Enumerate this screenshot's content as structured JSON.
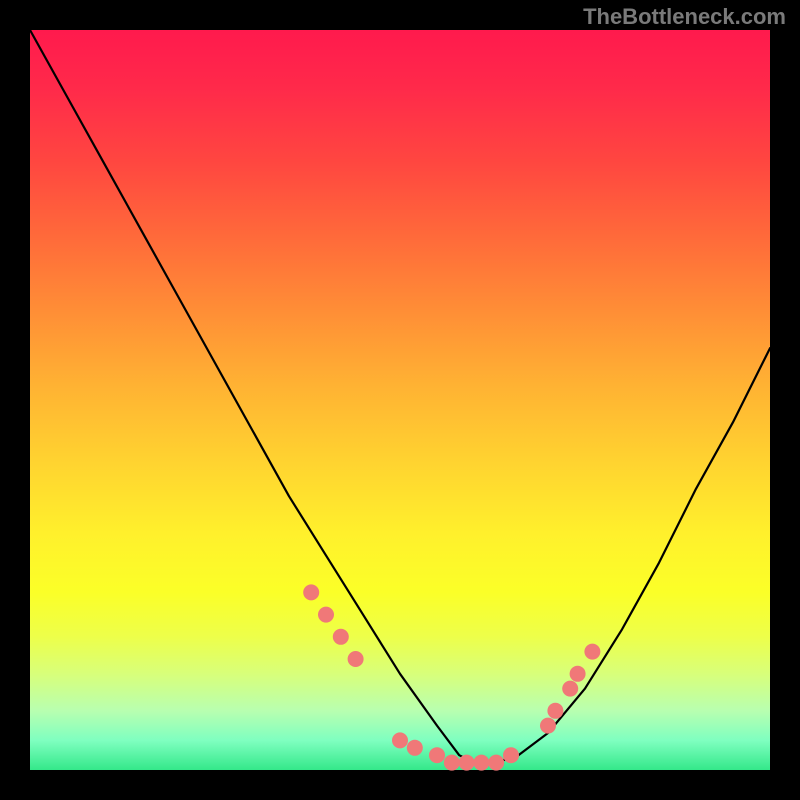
{
  "watermark": "TheBottleneck.com",
  "chart_data": {
    "type": "line",
    "title": "",
    "xlabel": "",
    "ylabel": "",
    "xlim": [
      0,
      100
    ],
    "ylim": [
      0,
      100
    ],
    "note": "Axes are unlabeled; x/y are normalized 0-100 percentages of the plot width/height. y=0 is the bottom (green) and y=100 is the top (red). The curve is a V/valley shape with its minimum near x≈58.",
    "series": [
      {
        "name": "bottleneck-curve",
        "x": [
          0,
          5,
          10,
          15,
          20,
          25,
          30,
          35,
          40,
          45,
          50,
          55,
          58,
          60,
          63,
          66,
          70,
          75,
          80,
          85,
          90,
          95,
          100
        ],
        "y": [
          100,
          91,
          82,
          73,
          64,
          55,
          46,
          37,
          29,
          21,
          13,
          6,
          2,
          1,
          1,
          2,
          5,
          11,
          19,
          28,
          38,
          47,
          57
        ]
      }
    ],
    "highlight_points": {
      "name": "salmon-dots",
      "color": "#f07878",
      "x": [
        38,
        40,
        42,
        44,
        50,
        52,
        55,
        57,
        59,
        61,
        63,
        65,
        70,
        71,
        73,
        74,
        76
      ],
      "y": [
        24,
        21,
        18,
        15,
        4,
        3,
        2,
        1,
        1,
        1,
        1,
        2,
        6,
        8,
        11,
        13,
        16
      ]
    }
  }
}
